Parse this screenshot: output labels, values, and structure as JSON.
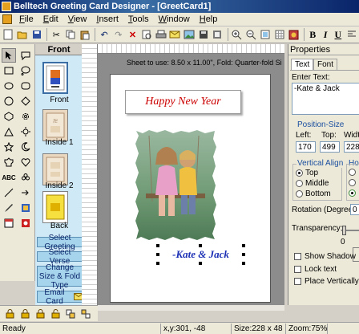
{
  "window": {
    "title": "Belltech Greeting Card Designer - [GreetCard1]"
  },
  "menu": [
    "File",
    "Edit",
    "View",
    "Insert",
    "Tools",
    "Window",
    "Help"
  ],
  "menu_underline": [
    "F",
    "E",
    "V",
    "I",
    "T",
    "W",
    "H"
  ],
  "menu_rest": [
    "ile",
    "dit",
    "iew",
    "nsert",
    "ools",
    "indow",
    "elp"
  ],
  "format": {
    "bold": "B",
    "italic": "I",
    "underline": "U"
  },
  "pages": {
    "header": "Front",
    "items": [
      "Front",
      "Inside 1",
      "Inside 2",
      "Back"
    ]
  },
  "actions": {
    "select_greeting": "Select Greeting",
    "select_verse": "Select Verse",
    "change_size": "Change Size & Fold Type",
    "email_card": "Email Card"
  },
  "canvas": {
    "sheet_info": "Sheet to use: 8.50 x 11.00\", Fold: Quarter-fold Si",
    "greeting_text": "Happy New Year",
    "signature_text": "-Kate & Jack"
  },
  "properties": {
    "title": "Properties",
    "tabs": [
      "Text",
      "Font"
    ],
    "enter_text_label": "Enter Text:",
    "enter_text_value": "-Kate & Jack",
    "position_size_label": "Position-Size",
    "left_label": "Left:",
    "top_label": "Top:",
    "width_label": "Width",
    "left_value": "170",
    "top_value": "499",
    "width_value": "228",
    "vertical_align_label": "Vertical Align",
    "horizontal_align_label": "Hor",
    "valign_options": [
      "Top",
      "Middle",
      "Bottom"
    ],
    "valign_selected": "Top",
    "rotation_label": "Rotation (Degree):",
    "rotation_value": "0",
    "transparency_label": "Transparency:",
    "transparency_value": "0",
    "checkboxes": [
      "Show Shadow",
      "Lock text",
      "Place Vertically"
    ]
  },
  "status": {
    "ready": "Ready",
    "coords": "x,y:301, -48",
    "size": "Size:228 x 48",
    "zoom": "Zoom:75%"
  },
  "colors": {
    "greeting": "#cc0000",
    "signature": "#1a2fb4",
    "pages_panel": "#cfe9f6",
    "accent_label": "#1a4fa0"
  }
}
